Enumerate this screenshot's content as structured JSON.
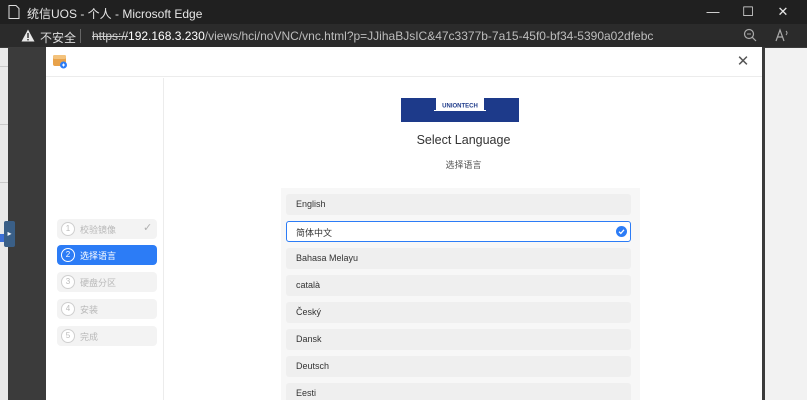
{
  "browser": {
    "title": "统信UOS - 个人 - Microsoft Edge",
    "insecure_label": "不安全",
    "url_scheme": "https://",
    "url_host": "192.168.3.230",
    "url_rest": "/views/hci/noVNC/vnc.html?p=JJihaBJsIC&47c3377b-7a15-45f0-bf34-5390a02dfebc"
  },
  "installer": {
    "logo_text": "UNIONTECH",
    "heading": "Select Language",
    "subheading": "选择语言",
    "steps": [
      {
        "num": "1",
        "label": "校验镜像",
        "done": true
      },
      {
        "num": "2",
        "label": "选择语言",
        "active": true
      },
      {
        "num": "3",
        "label": "硬盘分区"
      },
      {
        "num": "4",
        "label": "安装"
      },
      {
        "num": "5",
        "label": "完成"
      }
    ],
    "languages": [
      "English",
      "简体中文",
      "Bahasa Melayu",
      "català",
      "Český",
      "Dansk",
      "Deutsch",
      "Eesti"
    ],
    "selected_language": "简体中文"
  },
  "colors": {
    "accent": "#2c7cf6",
    "logo_navy": "#1d3a8a"
  },
  "icons": {
    "warning": "warning-icon",
    "check": "check-icon",
    "close": "close-icon"
  }
}
